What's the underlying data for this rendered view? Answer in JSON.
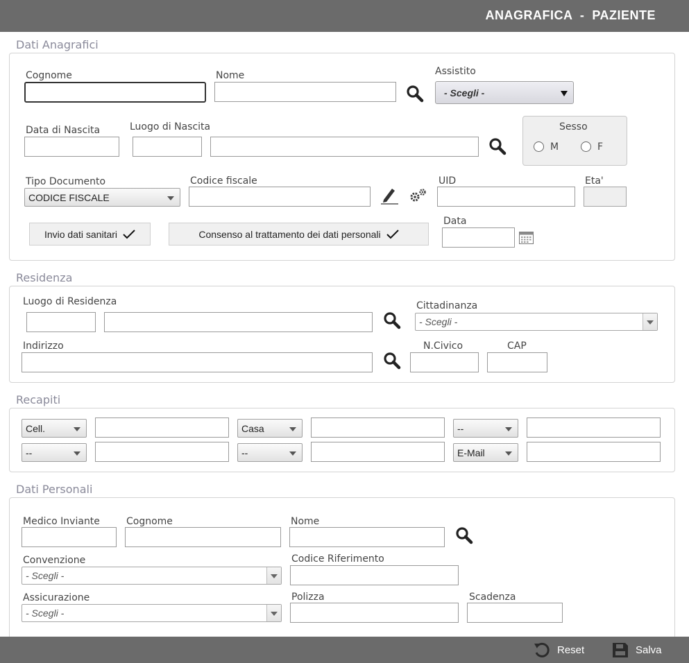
{
  "header": {
    "title": "ANAGRAFICA  -  PAZIENTE"
  },
  "sections": {
    "anagrafici": "Dati Anagrafici",
    "residenza": "Residenza",
    "recapiti": "Recapiti",
    "personali": "Dati Personali"
  },
  "anagrafici": {
    "cognome_label": "Cognome",
    "nome_label": "Nome",
    "assistito_label": "Assistito",
    "assistito_value": "- Scegli -",
    "data_nascita_label": "Data di Nascita",
    "luogo_nascita_label": "Luogo di Nascita",
    "sesso_label": "Sesso",
    "sesso_m": "M",
    "sesso_f": "F",
    "tipo_documento_label": "Tipo Documento",
    "tipo_documento_value": "CODICE FISCALE",
    "codice_fiscale_label": "Codice fiscale",
    "uid_label": "UID",
    "eta_label": "Eta'",
    "invio_dati_label": "Invio dati sanitari",
    "consenso_label": "Consenso al trattamento dei dati personali",
    "data_label": "Data"
  },
  "residenza": {
    "luogo_label": "Luogo di Residenza",
    "cittadinanza_label": "Cittadinanza",
    "cittadinanza_value": "- Scegli -",
    "indirizzo_label": "Indirizzo",
    "civico_label": "N.Civico",
    "cap_label": "CAP"
  },
  "recapiti": {
    "row1": [
      "Cell.",
      "Casa",
      "--"
    ],
    "row2": [
      "--",
      "--",
      "E-Mail"
    ]
  },
  "personali": {
    "medico_label": "Medico Inviante",
    "cognome_label": "Cognome",
    "nome_label": "Nome",
    "convenzione_label": "Convenzione",
    "convenzione_value": "- Scegli -",
    "codice_rif_label": "Codice Riferimento",
    "assicurazione_label": "Assicurazione",
    "assicurazione_value": "- Scegli -",
    "polizza_label": "Polizza",
    "scadenza_label": "Scadenza"
  },
  "footer": {
    "reset_label": "Reset",
    "salva_label": "Salva"
  },
  "colors": {
    "bar": "#6b6b6b",
    "section_title": "#8a8a9a",
    "panel_border": "#d3d3d3"
  },
  "icons": [
    "search-icon",
    "pencil-icon",
    "gears-icon",
    "calendar-icon",
    "checkmark-icon",
    "reset-icon",
    "save-icon"
  ]
}
